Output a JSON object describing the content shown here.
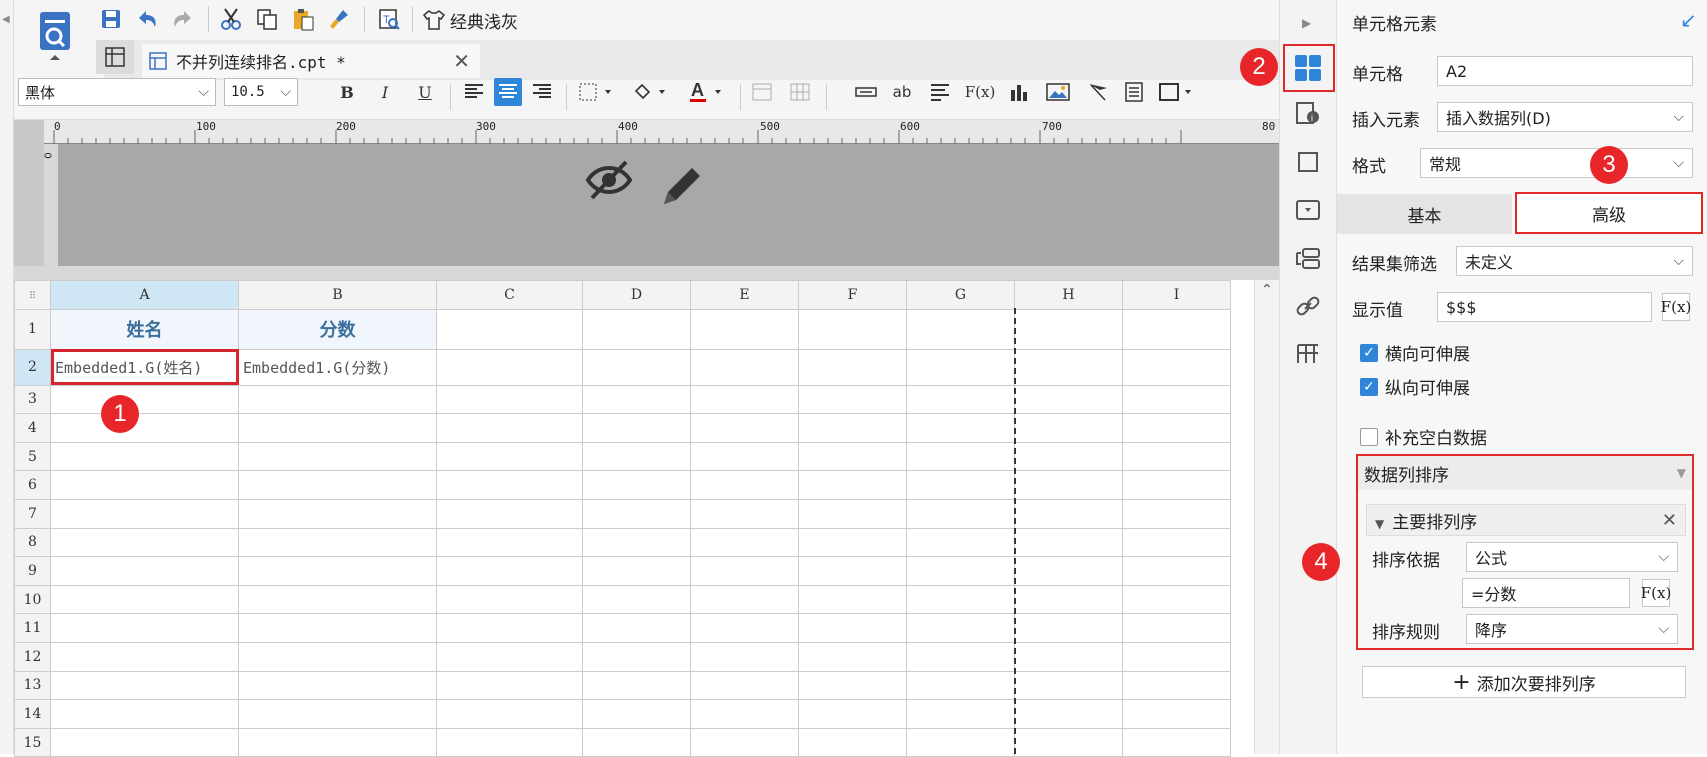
{
  "toolbar": {
    "theme_label": "经典浅灰"
  },
  "tab": {
    "filename": "不并列连续排名.cpt *"
  },
  "format": {
    "font": "黑体",
    "size": "10.5",
    "fx_label": "F(x)",
    "ab_label": "ab",
    "bold": "B",
    "italic": "I",
    "underline": "U",
    "font_color": "A"
  },
  "ruler": {
    "ticks": [
      "0",
      "100",
      "200",
      "300",
      "400",
      "500",
      "600",
      "700",
      "80"
    ],
    "vtick": "0"
  },
  "sheet": {
    "columns": [
      "A",
      "B",
      "C",
      "D",
      "E",
      "F",
      "G",
      "H",
      "I"
    ],
    "rows": [
      "1",
      "2",
      "3",
      "4",
      "5",
      "6",
      "7",
      "8",
      "9",
      "10",
      "11",
      "12",
      "13",
      "14",
      "15"
    ],
    "a1": "姓名",
    "b1": "分数",
    "a2": "Embedded1.G(姓名)",
    "b2": "Embedded1.G(分数)"
  },
  "badges": [
    "1",
    "2",
    "3",
    "4"
  ],
  "panel": {
    "title": "单元格元素",
    "cell_label": "单元格",
    "cell_value": "A2",
    "insert_label": "插入元素",
    "insert_value": "插入数据列(D)",
    "format_label": "格式",
    "format_value": "常规",
    "tab_basic": "基本",
    "tab_advanced": "高级",
    "filter_label": "结果集筛选",
    "filter_value": "未定义",
    "display_label": "显示值",
    "display_value": "$$$",
    "fx_label": "F(x)",
    "chk_horizontal": "横向可伸展",
    "chk_vertical": "纵向可伸展",
    "chk_fill": "补充空白数据",
    "sort_section": "数据列排序",
    "primary_sort": "主要排列序",
    "sort_by_label": "排序依据",
    "sort_by_value": "公式",
    "formula_value": "=分数",
    "sort_rule_label": "排序规则",
    "sort_rule_value": "降序",
    "add_secondary": "添加次要排列序"
  },
  "colors": {
    "accent": "#2f86d9",
    "highlight_red": "#e02a2a",
    "header_text": "#3c6e9c"
  }
}
